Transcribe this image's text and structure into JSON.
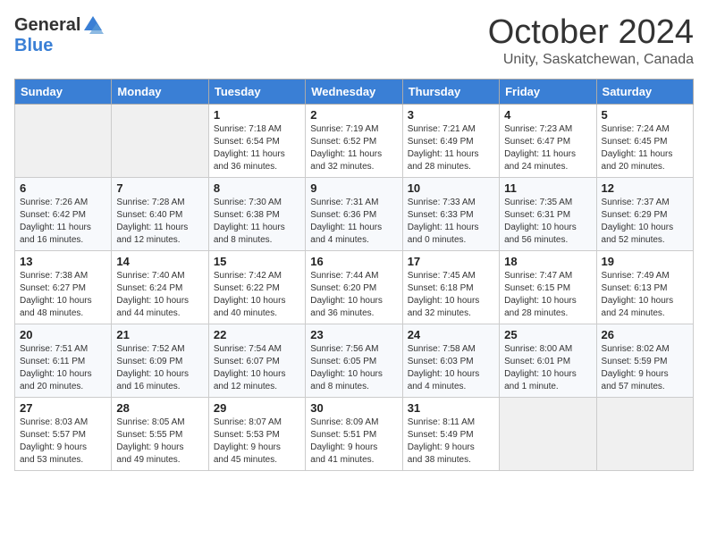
{
  "logo": {
    "general": "General",
    "blue": "Blue"
  },
  "title": "October 2024",
  "location": "Unity, Saskatchewan, Canada",
  "days_header": [
    "Sunday",
    "Monday",
    "Tuesday",
    "Wednesday",
    "Thursday",
    "Friday",
    "Saturday"
  ],
  "weeks": [
    [
      {
        "day": "",
        "content": ""
      },
      {
        "day": "",
        "content": ""
      },
      {
        "day": "1",
        "content": "Sunrise: 7:18 AM\nSunset: 6:54 PM\nDaylight: 11 hours\nand 36 minutes."
      },
      {
        "day": "2",
        "content": "Sunrise: 7:19 AM\nSunset: 6:52 PM\nDaylight: 11 hours\nand 32 minutes."
      },
      {
        "day": "3",
        "content": "Sunrise: 7:21 AM\nSunset: 6:49 PM\nDaylight: 11 hours\nand 28 minutes."
      },
      {
        "day": "4",
        "content": "Sunrise: 7:23 AM\nSunset: 6:47 PM\nDaylight: 11 hours\nand 24 minutes."
      },
      {
        "day": "5",
        "content": "Sunrise: 7:24 AM\nSunset: 6:45 PM\nDaylight: 11 hours\nand 20 minutes."
      }
    ],
    [
      {
        "day": "6",
        "content": "Sunrise: 7:26 AM\nSunset: 6:42 PM\nDaylight: 11 hours\nand 16 minutes."
      },
      {
        "day": "7",
        "content": "Sunrise: 7:28 AM\nSunset: 6:40 PM\nDaylight: 11 hours\nand 12 minutes."
      },
      {
        "day": "8",
        "content": "Sunrise: 7:30 AM\nSunset: 6:38 PM\nDaylight: 11 hours\nand 8 minutes."
      },
      {
        "day": "9",
        "content": "Sunrise: 7:31 AM\nSunset: 6:36 PM\nDaylight: 11 hours\nand 4 minutes."
      },
      {
        "day": "10",
        "content": "Sunrise: 7:33 AM\nSunset: 6:33 PM\nDaylight: 11 hours\nand 0 minutes."
      },
      {
        "day": "11",
        "content": "Sunrise: 7:35 AM\nSunset: 6:31 PM\nDaylight: 10 hours\nand 56 minutes."
      },
      {
        "day": "12",
        "content": "Sunrise: 7:37 AM\nSunset: 6:29 PM\nDaylight: 10 hours\nand 52 minutes."
      }
    ],
    [
      {
        "day": "13",
        "content": "Sunrise: 7:38 AM\nSunset: 6:27 PM\nDaylight: 10 hours\nand 48 minutes."
      },
      {
        "day": "14",
        "content": "Sunrise: 7:40 AM\nSunset: 6:24 PM\nDaylight: 10 hours\nand 44 minutes."
      },
      {
        "day": "15",
        "content": "Sunrise: 7:42 AM\nSunset: 6:22 PM\nDaylight: 10 hours\nand 40 minutes."
      },
      {
        "day": "16",
        "content": "Sunrise: 7:44 AM\nSunset: 6:20 PM\nDaylight: 10 hours\nand 36 minutes."
      },
      {
        "day": "17",
        "content": "Sunrise: 7:45 AM\nSunset: 6:18 PM\nDaylight: 10 hours\nand 32 minutes."
      },
      {
        "day": "18",
        "content": "Sunrise: 7:47 AM\nSunset: 6:15 PM\nDaylight: 10 hours\nand 28 minutes."
      },
      {
        "day": "19",
        "content": "Sunrise: 7:49 AM\nSunset: 6:13 PM\nDaylight: 10 hours\nand 24 minutes."
      }
    ],
    [
      {
        "day": "20",
        "content": "Sunrise: 7:51 AM\nSunset: 6:11 PM\nDaylight: 10 hours\nand 20 minutes."
      },
      {
        "day": "21",
        "content": "Sunrise: 7:52 AM\nSunset: 6:09 PM\nDaylight: 10 hours\nand 16 minutes."
      },
      {
        "day": "22",
        "content": "Sunrise: 7:54 AM\nSunset: 6:07 PM\nDaylight: 10 hours\nand 12 minutes."
      },
      {
        "day": "23",
        "content": "Sunrise: 7:56 AM\nSunset: 6:05 PM\nDaylight: 10 hours\nand 8 minutes."
      },
      {
        "day": "24",
        "content": "Sunrise: 7:58 AM\nSunset: 6:03 PM\nDaylight: 10 hours\nand 4 minutes."
      },
      {
        "day": "25",
        "content": "Sunrise: 8:00 AM\nSunset: 6:01 PM\nDaylight: 10 hours\nand 1 minute."
      },
      {
        "day": "26",
        "content": "Sunrise: 8:02 AM\nSunset: 5:59 PM\nDaylight: 9 hours\nand 57 minutes."
      }
    ],
    [
      {
        "day": "27",
        "content": "Sunrise: 8:03 AM\nSunset: 5:57 PM\nDaylight: 9 hours\nand 53 minutes."
      },
      {
        "day": "28",
        "content": "Sunrise: 8:05 AM\nSunset: 5:55 PM\nDaylight: 9 hours\nand 49 minutes."
      },
      {
        "day": "29",
        "content": "Sunrise: 8:07 AM\nSunset: 5:53 PM\nDaylight: 9 hours\nand 45 minutes."
      },
      {
        "day": "30",
        "content": "Sunrise: 8:09 AM\nSunset: 5:51 PM\nDaylight: 9 hours\nand 41 minutes."
      },
      {
        "day": "31",
        "content": "Sunrise: 8:11 AM\nSunset: 5:49 PM\nDaylight: 9 hours\nand 38 minutes."
      },
      {
        "day": "",
        "content": ""
      },
      {
        "day": "",
        "content": ""
      }
    ]
  ]
}
